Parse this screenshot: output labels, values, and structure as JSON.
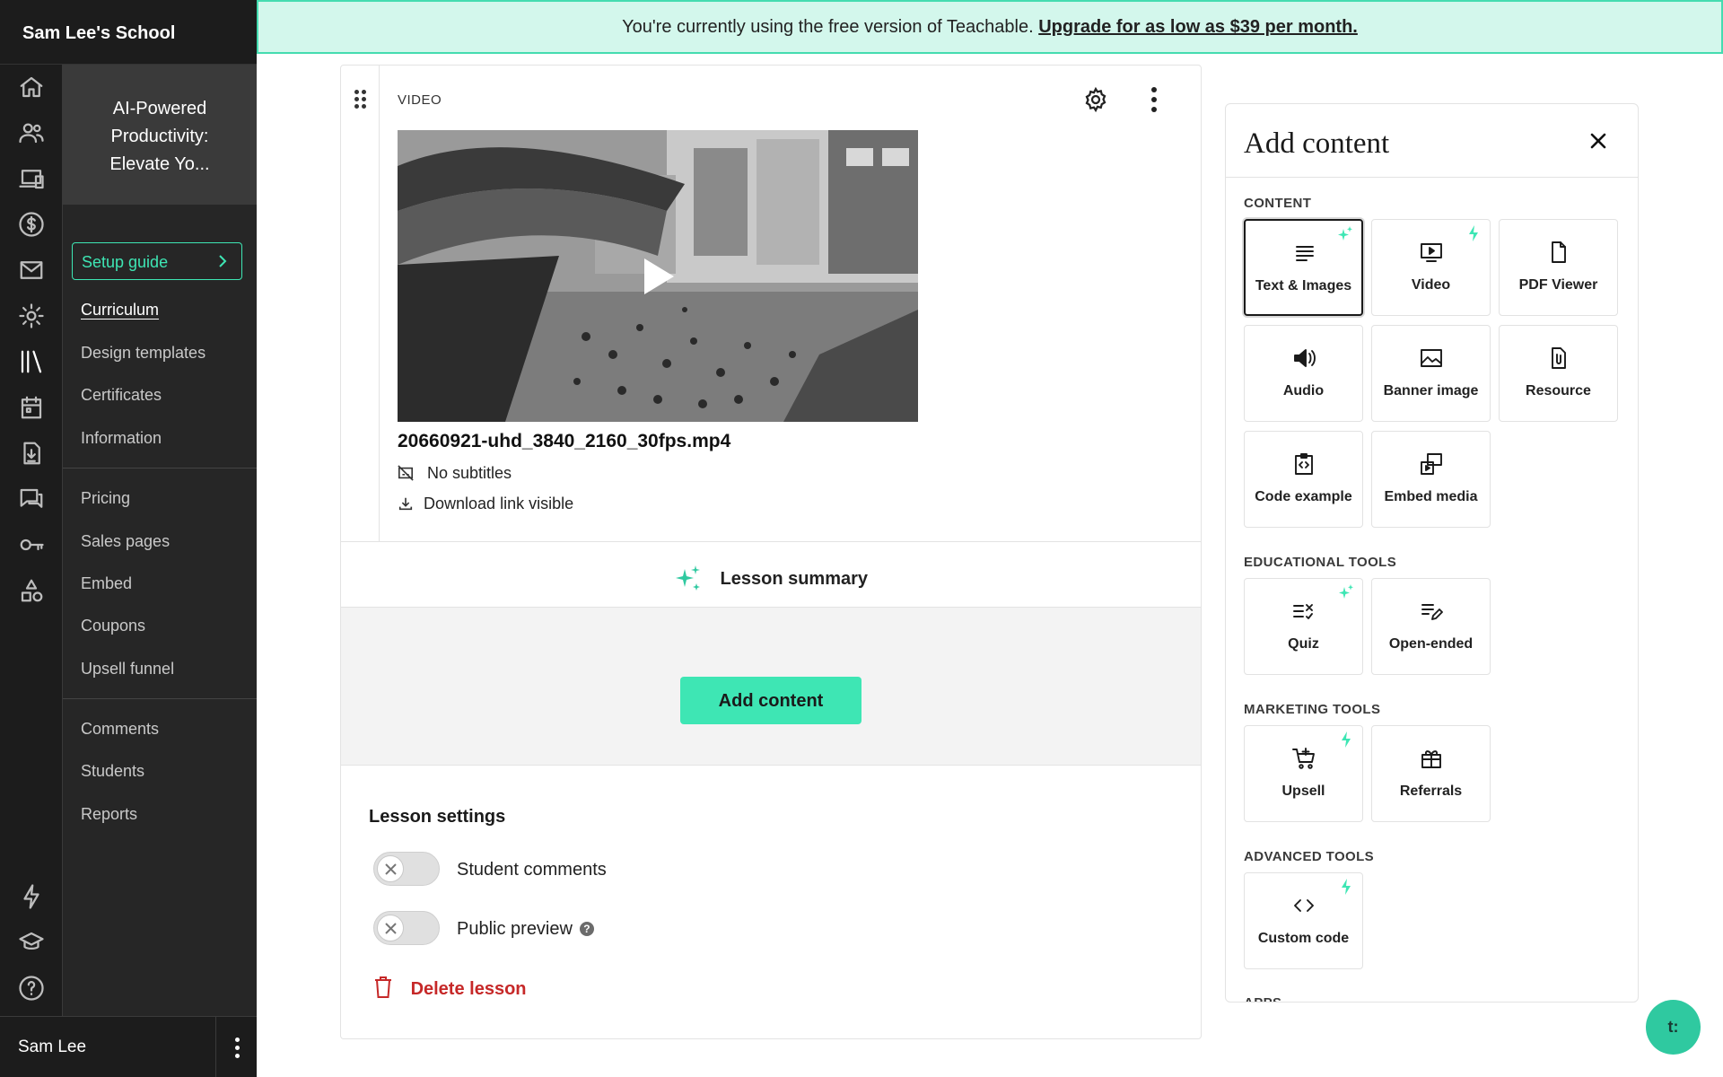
{
  "school": {
    "name": "Sam Lee's School"
  },
  "banner": {
    "text": "You're currently using the free version of Teachable. ",
    "link": "Upgrade for as low as $39 per month."
  },
  "rail_icons": [
    "home-icon",
    "users-icon",
    "devices-icon",
    "dollar-icon",
    "mail-icon",
    "gear-icon",
    "library-icon",
    "calendar-icon",
    "download-doc-icon",
    "chat-icon",
    "key-icon",
    "shapes-icon",
    "bolt-icon",
    "graduation-cap-icon",
    "help-icon"
  ],
  "sidebar": {
    "course_title": "AI-Powered Productivity: Elevate Yo...",
    "setup_guide": "Setup guide",
    "group1": [
      "Curriculum",
      "Design templates",
      "Certificates",
      "Information"
    ],
    "group2": [
      "Pricing",
      "Sales pages",
      "Embed",
      "Coupons",
      "Upsell funnel"
    ],
    "group3": [
      "Comments",
      "Students",
      "Reports"
    ],
    "active": "Curriculum"
  },
  "user": {
    "name": "Sam Lee"
  },
  "video_block": {
    "label": "VIDEO",
    "filename": "20660921-uhd_3840_2160_30fps.mp4",
    "subtitles": "No subtitles",
    "download": "Download link visible"
  },
  "lesson": {
    "summary": "Lesson summary",
    "add_content_button": "Add content",
    "settings_title": "Lesson settings",
    "student_comments": "Student comments",
    "public_preview": "Public preview",
    "help_mark": "?",
    "delete": "Delete lesson"
  },
  "panel": {
    "title": "Add content",
    "sections": {
      "content": "CONTENT",
      "educational": "EDUCATIONAL TOOLS",
      "marketing": "MARKETING TOOLS",
      "advanced": "ADVANCED TOOLS",
      "apps": "APPS"
    },
    "tiles": {
      "text_images": "Text & Images",
      "video": "Video",
      "pdf_viewer": "PDF Viewer",
      "audio": "Audio",
      "banner_image": "Banner image",
      "resource": "Resource",
      "code_example": "Code example",
      "embed_media": "Embed media",
      "quiz": "Quiz",
      "open_ended": "Open-ended",
      "upsell": "Upsell",
      "referrals": "Referrals",
      "custom_code": "Custom code"
    }
  },
  "chat": {
    "label": "t:"
  },
  "colors": {
    "accent": "#3ee6b4",
    "danger": "#c62828",
    "sidebar": "#262626"
  }
}
